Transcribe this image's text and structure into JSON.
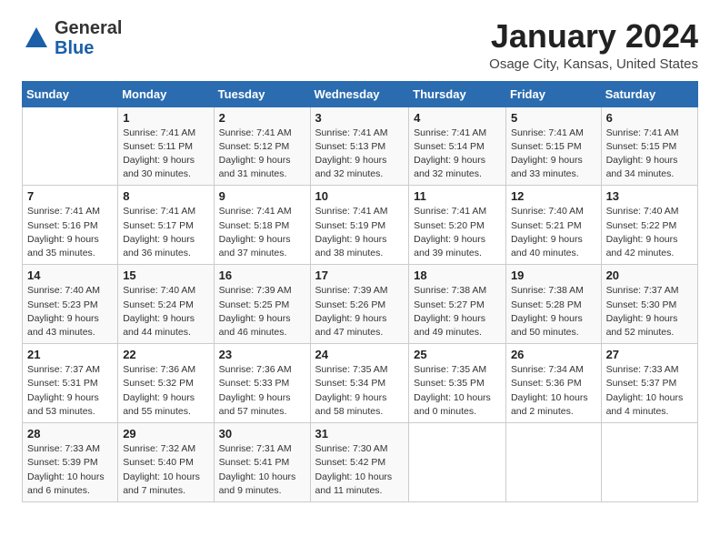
{
  "header": {
    "logo_line1": "General",
    "logo_line2": "Blue",
    "title": "January 2024",
    "subtitle": "Osage City, Kansas, United States"
  },
  "calendar": {
    "days_of_week": [
      "Sunday",
      "Monday",
      "Tuesday",
      "Wednesday",
      "Thursday",
      "Friday",
      "Saturday"
    ],
    "weeks": [
      [
        {
          "day": "",
          "info": ""
        },
        {
          "day": "1",
          "info": "Sunrise: 7:41 AM\nSunset: 5:11 PM\nDaylight: 9 hours\nand 30 minutes."
        },
        {
          "day": "2",
          "info": "Sunrise: 7:41 AM\nSunset: 5:12 PM\nDaylight: 9 hours\nand 31 minutes."
        },
        {
          "day": "3",
          "info": "Sunrise: 7:41 AM\nSunset: 5:13 PM\nDaylight: 9 hours\nand 32 minutes."
        },
        {
          "day": "4",
          "info": "Sunrise: 7:41 AM\nSunset: 5:14 PM\nDaylight: 9 hours\nand 32 minutes."
        },
        {
          "day": "5",
          "info": "Sunrise: 7:41 AM\nSunset: 5:15 PM\nDaylight: 9 hours\nand 33 minutes."
        },
        {
          "day": "6",
          "info": "Sunrise: 7:41 AM\nSunset: 5:15 PM\nDaylight: 9 hours\nand 34 minutes."
        }
      ],
      [
        {
          "day": "7",
          "info": "Sunrise: 7:41 AM\nSunset: 5:16 PM\nDaylight: 9 hours\nand 35 minutes."
        },
        {
          "day": "8",
          "info": "Sunrise: 7:41 AM\nSunset: 5:17 PM\nDaylight: 9 hours\nand 36 minutes."
        },
        {
          "day": "9",
          "info": "Sunrise: 7:41 AM\nSunset: 5:18 PM\nDaylight: 9 hours\nand 37 minutes."
        },
        {
          "day": "10",
          "info": "Sunrise: 7:41 AM\nSunset: 5:19 PM\nDaylight: 9 hours\nand 38 minutes."
        },
        {
          "day": "11",
          "info": "Sunrise: 7:41 AM\nSunset: 5:20 PM\nDaylight: 9 hours\nand 39 minutes."
        },
        {
          "day": "12",
          "info": "Sunrise: 7:40 AM\nSunset: 5:21 PM\nDaylight: 9 hours\nand 40 minutes."
        },
        {
          "day": "13",
          "info": "Sunrise: 7:40 AM\nSunset: 5:22 PM\nDaylight: 9 hours\nand 42 minutes."
        }
      ],
      [
        {
          "day": "14",
          "info": "Sunrise: 7:40 AM\nSunset: 5:23 PM\nDaylight: 9 hours\nand 43 minutes."
        },
        {
          "day": "15",
          "info": "Sunrise: 7:40 AM\nSunset: 5:24 PM\nDaylight: 9 hours\nand 44 minutes."
        },
        {
          "day": "16",
          "info": "Sunrise: 7:39 AM\nSunset: 5:25 PM\nDaylight: 9 hours\nand 46 minutes."
        },
        {
          "day": "17",
          "info": "Sunrise: 7:39 AM\nSunset: 5:26 PM\nDaylight: 9 hours\nand 47 minutes."
        },
        {
          "day": "18",
          "info": "Sunrise: 7:38 AM\nSunset: 5:27 PM\nDaylight: 9 hours\nand 49 minutes."
        },
        {
          "day": "19",
          "info": "Sunrise: 7:38 AM\nSunset: 5:28 PM\nDaylight: 9 hours\nand 50 minutes."
        },
        {
          "day": "20",
          "info": "Sunrise: 7:37 AM\nSunset: 5:30 PM\nDaylight: 9 hours\nand 52 minutes."
        }
      ],
      [
        {
          "day": "21",
          "info": "Sunrise: 7:37 AM\nSunset: 5:31 PM\nDaylight: 9 hours\nand 53 minutes."
        },
        {
          "day": "22",
          "info": "Sunrise: 7:36 AM\nSunset: 5:32 PM\nDaylight: 9 hours\nand 55 minutes."
        },
        {
          "day": "23",
          "info": "Sunrise: 7:36 AM\nSunset: 5:33 PM\nDaylight: 9 hours\nand 57 minutes."
        },
        {
          "day": "24",
          "info": "Sunrise: 7:35 AM\nSunset: 5:34 PM\nDaylight: 9 hours\nand 58 minutes."
        },
        {
          "day": "25",
          "info": "Sunrise: 7:35 AM\nSunset: 5:35 PM\nDaylight: 10 hours\nand 0 minutes."
        },
        {
          "day": "26",
          "info": "Sunrise: 7:34 AM\nSunset: 5:36 PM\nDaylight: 10 hours\nand 2 minutes."
        },
        {
          "day": "27",
          "info": "Sunrise: 7:33 AM\nSunset: 5:37 PM\nDaylight: 10 hours\nand 4 minutes."
        }
      ],
      [
        {
          "day": "28",
          "info": "Sunrise: 7:33 AM\nSunset: 5:39 PM\nDaylight: 10 hours\nand 6 minutes."
        },
        {
          "day": "29",
          "info": "Sunrise: 7:32 AM\nSunset: 5:40 PM\nDaylight: 10 hours\nand 7 minutes."
        },
        {
          "day": "30",
          "info": "Sunrise: 7:31 AM\nSunset: 5:41 PM\nDaylight: 10 hours\nand 9 minutes."
        },
        {
          "day": "31",
          "info": "Sunrise: 7:30 AM\nSunset: 5:42 PM\nDaylight: 10 hours\nand 11 minutes."
        },
        {
          "day": "",
          "info": ""
        },
        {
          "day": "",
          "info": ""
        },
        {
          "day": "",
          "info": ""
        }
      ]
    ]
  }
}
